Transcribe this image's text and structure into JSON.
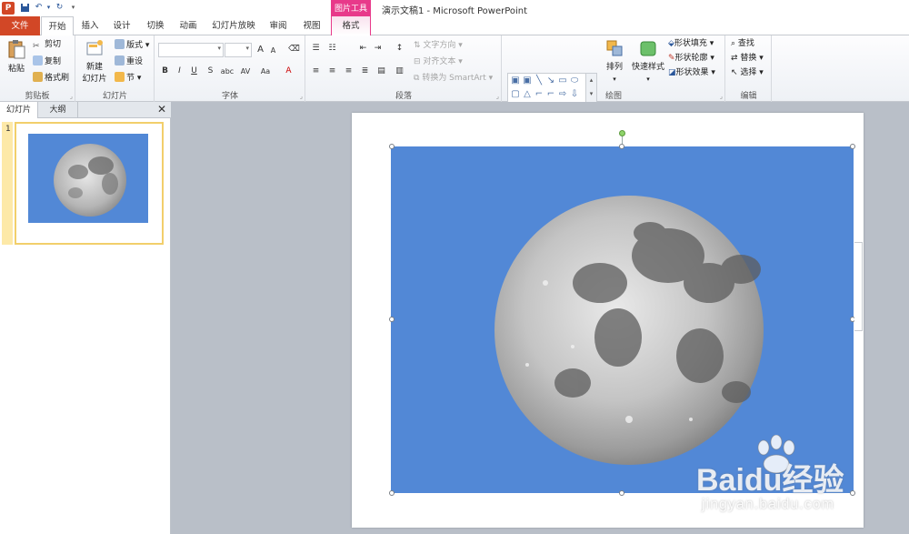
{
  "window": {
    "title": "演示文稿1 - Microsoft PowerPoint",
    "app_icon": "P"
  },
  "quick_access": {
    "save": "save-icon",
    "undo": "undo-icon",
    "redo": "redo-icon",
    "customize": "▾"
  },
  "context_tab_group": {
    "label": "图片工具",
    "color": "#e8398a"
  },
  "tabs": [
    {
      "label": "文件"
    },
    {
      "label": "开始"
    },
    {
      "label": "插入"
    },
    {
      "label": "设计"
    },
    {
      "label": "切换"
    },
    {
      "label": "动画"
    },
    {
      "label": "幻灯片放映"
    },
    {
      "label": "审阅"
    },
    {
      "label": "视图"
    },
    {
      "label": "格式"
    }
  ],
  "ribbon": {
    "clipboard": {
      "label": "剪贴板",
      "paste": "粘贴",
      "cut": "剪切",
      "copy": "复制",
      "format_painter": "格式刷"
    },
    "slides": {
      "label": "幻灯片",
      "new_slide_line1": "新建",
      "new_slide_line2": "幻灯片",
      "layout": "版式",
      "reset": "重设",
      "section": "节"
    },
    "font": {
      "label": "字体",
      "bold": "B",
      "italic": "I",
      "underline": "U",
      "strike": "S",
      "shadow": "abc",
      "spacing": "AV",
      "case": "Aa",
      "grow": "A",
      "shrink": "A"
    },
    "paragraph": {
      "label": "段落",
      "text_direction": "文字方向",
      "align_text": "对齐文本",
      "convert_smartart": "转换为 SmartArt"
    },
    "drawing": {
      "label": "绘图",
      "arrange": "排列",
      "quick_styles": "快速样式",
      "shape_fill": "形状填充",
      "shape_outline": "形状轮廓",
      "shape_effects": "形状效果"
    },
    "editing": {
      "label": "编辑",
      "find": "查找",
      "replace": "替换",
      "select": "选择"
    }
  },
  "slide_pane": {
    "tab_slides": "幻灯片",
    "tab_outline": "大纲",
    "close": "✕",
    "slide_number": "1"
  },
  "colors": {
    "accent": "#d24726",
    "slide_bg": "#5288d6",
    "selection": "#f2cf6b"
  },
  "watermark": {
    "brand": "Baidu经验",
    "site": "jingyan.baidu.com"
  }
}
